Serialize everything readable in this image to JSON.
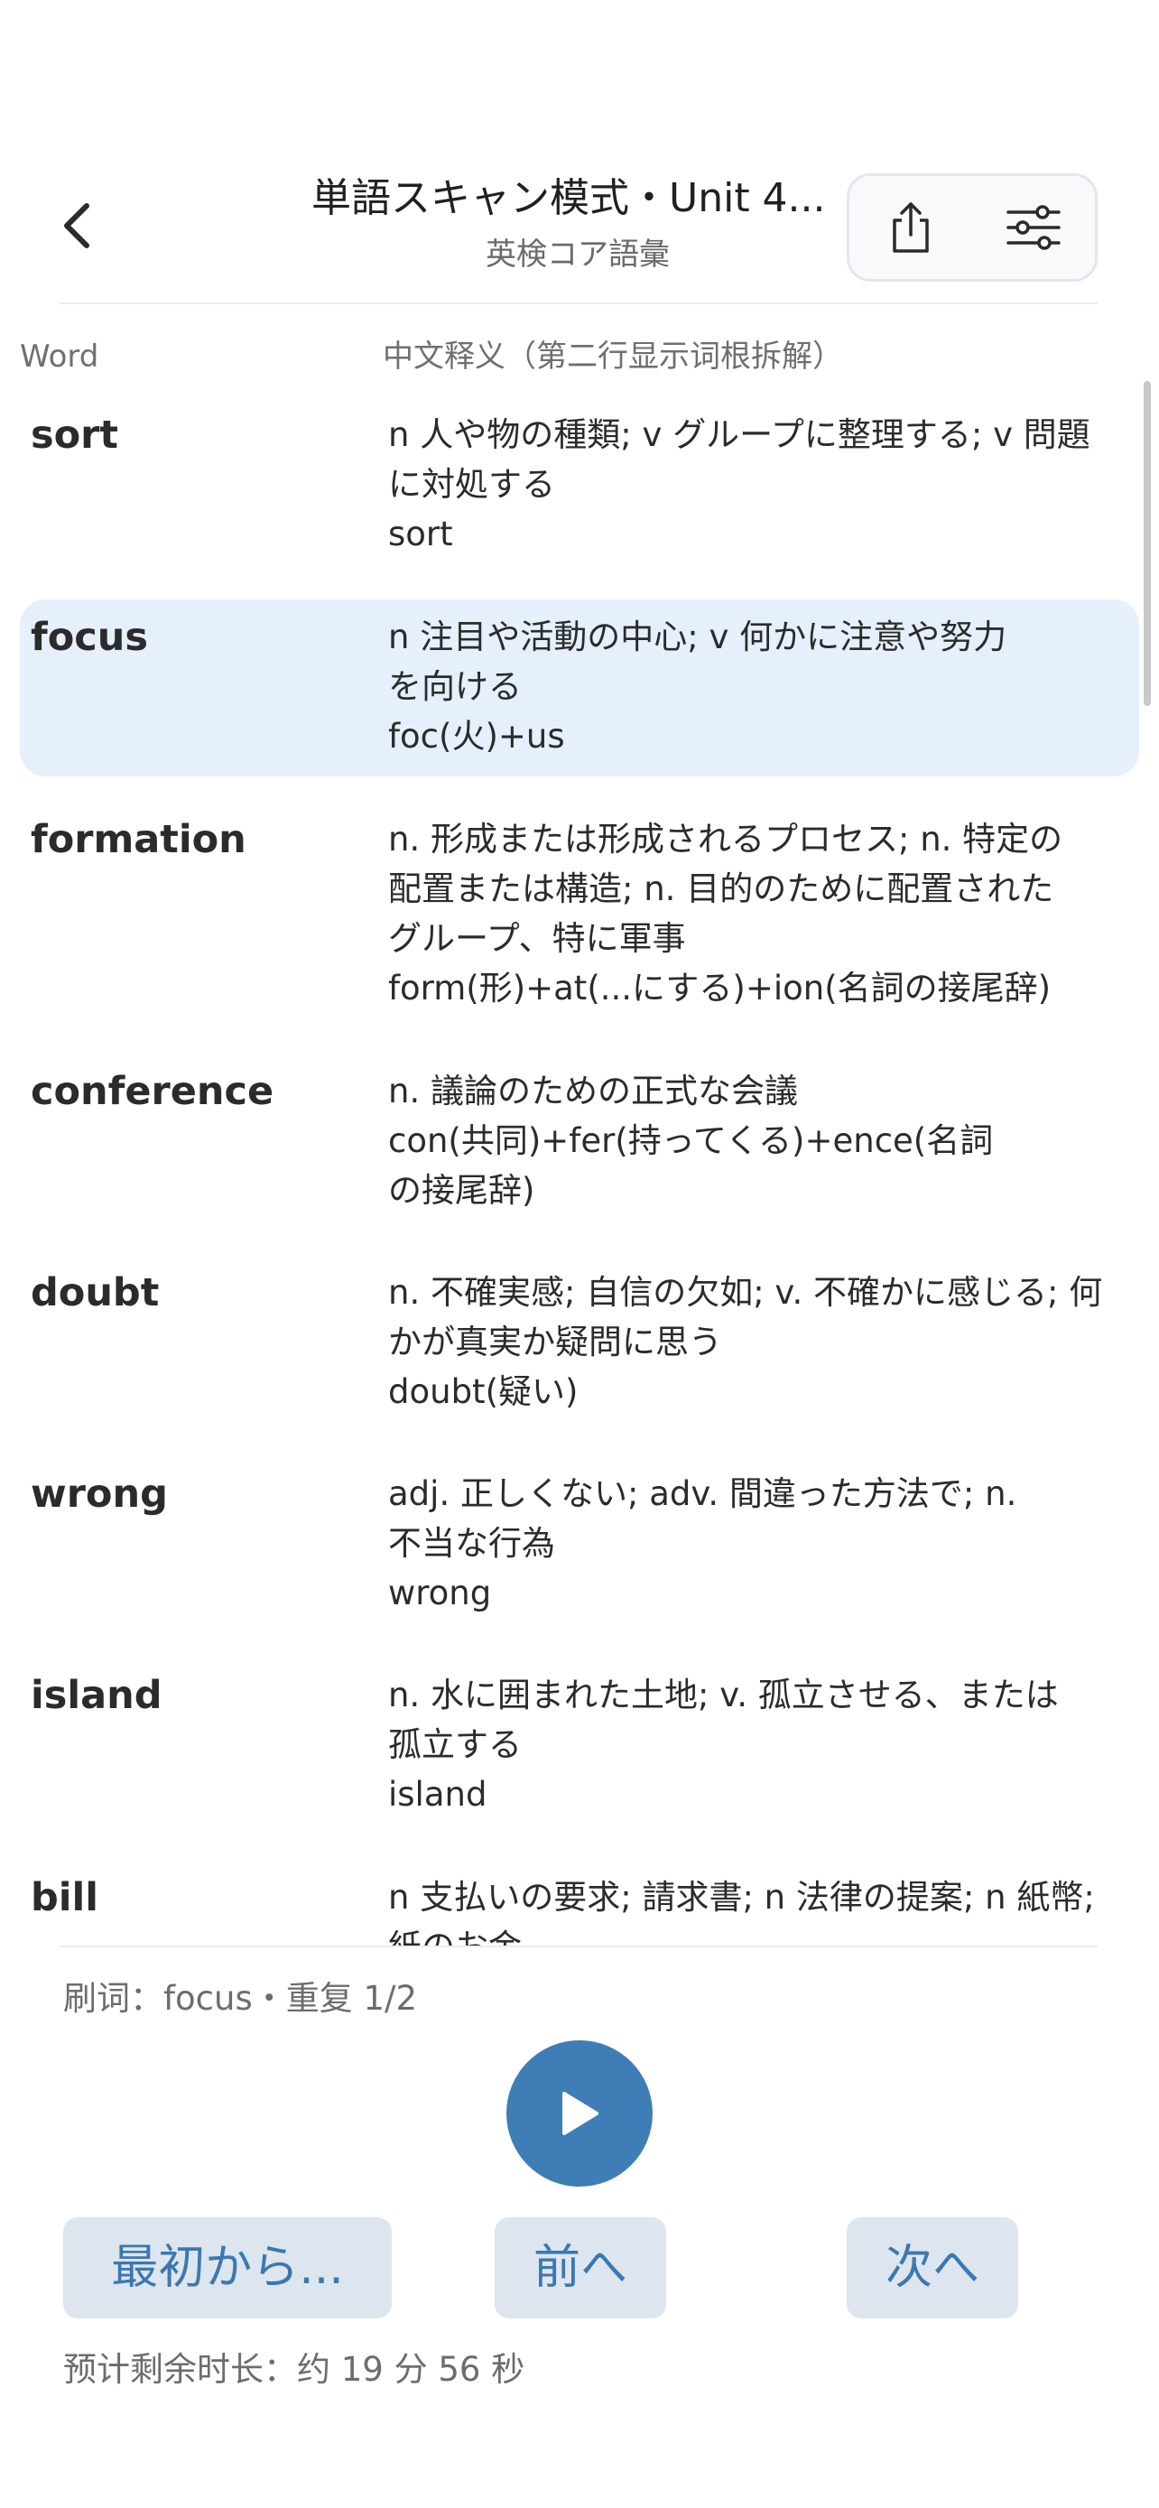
{
  "header": {
    "title": "単語スキャン模式・Unit 4...",
    "subtitle": "英検コア語彙"
  },
  "icons": {
    "back": "chevron-left-icon",
    "share": "share-icon",
    "settings": "sliders-icon",
    "play": "play-icon"
  },
  "table": {
    "word_header": "Word",
    "definition_header": "中文释义（第二行显示词根拆解）"
  },
  "rows": [
    {
      "word": "sort",
      "lines": [
        "n 人や物の種類; v グループに整理する; v 問題",
        "に対処する",
        "sort"
      ],
      "active": false
    },
    {
      "word": "focus",
      "lines": [
        "n 注目や活動の中心; v 何かに注意や努力",
        "を向ける",
        "foc(火)+us"
      ],
      "active": true
    },
    {
      "word": "formation",
      "lines": [
        "n. 形成または形成されるプロセス; n. 特定の",
        "配置または構造; n. 目的のために配置された",
        "グループ、特に軍事",
        "form(形)+at(...にする)+ion(名詞の接尾辞)"
      ],
      "active": false
    },
    {
      "word": "conference",
      "lines": [
        "n. 議論のための正式な会議",
        "con(共同)+fer(持ってくる)+ence(名詞",
        "の接尾辞)"
      ],
      "active": false
    },
    {
      "word": "doubt",
      "lines": [
        "n. 不確実感; 自信の欠如; v. 不確かに感じる; 何",
        "かが真実か疑問に思う",
        "doubt(疑い)"
      ],
      "active": false
    },
    {
      "word": "wrong",
      "lines": [
        "adj. 正しくない; adv. 間違った方法で; n.",
        "不当な行為",
        "wrong"
      ],
      "active": false
    },
    {
      "word": "island",
      "lines": [
        "n. 水に囲まれた土地; v. 孤立させる、または",
        "孤立する",
        "island"
      ],
      "active": false
    },
    {
      "word": "bill",
      "lines": [
        "n 支払いの要求; 請求書; n 法律の提案; n 紙幣;",
        "紙のお金"
      ],
      "active": false
    }
  ],
  "footer": {
    "status": "刷词：focus・重复 1/2",
    "restart_label": "最初から...",
    "prev_label": "前へ",
    "next_label": "次へ",
    "remaining": "预计剩余时长：约 19 分 56 秒"
  },
  "colors": {
    "accent": "#3f7db6",
    "active_row": "#e5f0fc",
    "button_bg": "#dde6ee"
  }
}
